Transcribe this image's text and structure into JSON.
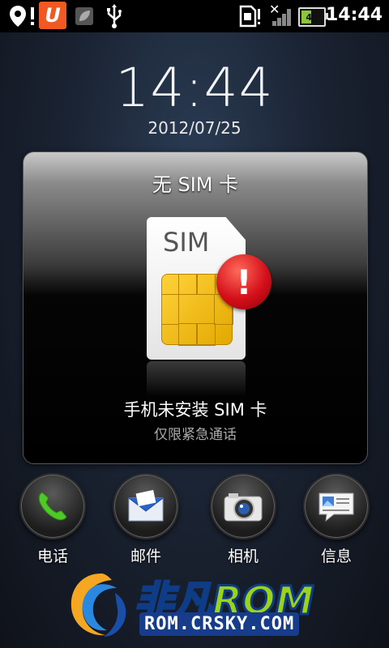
{
  "status_bar": {
    "time": "14:44",
    "battery_level": "49",
    "battery_fill": 0.49,
    "icons": [
      "location-alert-icon",
      "uc-browser-icon",
      "leaf-icon",
      "usb-icon",
      "sim-missing-icon",
      "no-signal-icon",
      "battery-icon"
    ]
  },
  "lockscreen": {
    "clock": "14:44",
    "date": "2012/07/25"
  },
  "sim_card": {
    "title": "无 SIM 卡",
    "sim_label": "SIM",
    "warning_glyph": "!",
    "message": "手机未安装 SIM 卡",
    "sub_message": "仅限紧急通话"
  },
  "dock": {
    "items": [
      {
        "label": "电话",
        "icon": "phone-icon"
      },
      {
        "label": "邮件",
        "icon": "mail-icon"
      },
      {
        "label": "相机",
        "icon": "camera-icon"
      },
      {
        "label": "信息",
        "icon": "message-icon"
      }
    ]
  },
  "watermark": {
    "brand_main": "非凡",
    "brand_rom": "ROM",
    "url": "ROM.CRSKY.COM"
  },
  "colors": {
    "warning_red": "#d4101a",
    "chip_gold": "#ffd23a",
    "battery_green": "#8cc63f",
    "logo_green": "#9bd21b",
    "logo_blue": "#173c8c"
  }
}
